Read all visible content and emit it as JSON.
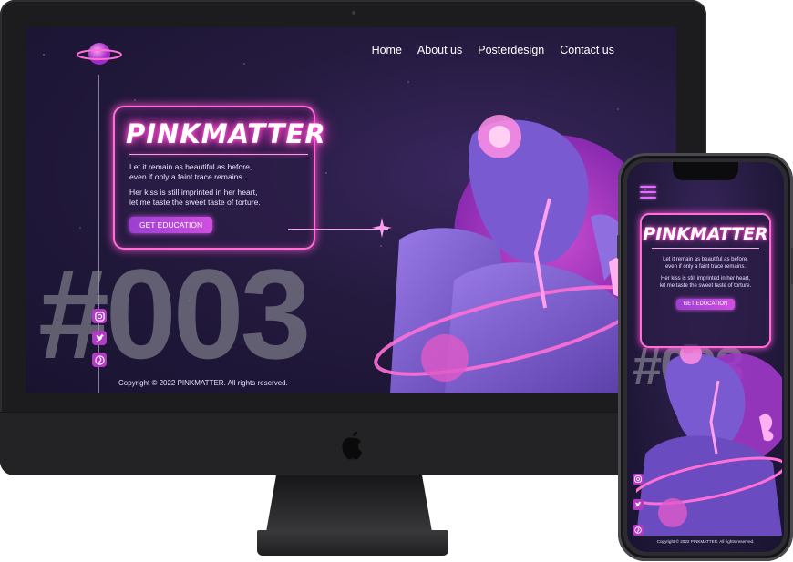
{
  "nav": {
    "items": [
      "Home",
      "About us",
      "Posterdesign",
      "Contact us"
    ]
  },
  "hero": {
    "brand": "PINKMATTER",
    "paragraph1_line1": "Let it remain as beautiful as before,",
    "paragraph1_line2": "even if only a faint trace remains.",
    "paragraph2_line1": "Her kiss is still imprinted in her heart,",
    "paragraph2_line2": "let me taste the sweet taste of torture.",
    "cta_label": "GET EDUCATION",
    "big_number": "#003"
  },
  "phone": {
    "big_number": "#003"
  },
  "social": {
    "icons": [
      "instagram-icon",
      "twitter-icon",
      "pinterest-icon"
    ]
  },
  "footer": {
    "copyright": "Copyright © 2022 PINKMATTER. All rights reserved."
  },
  "colors": {
    "accent_pink": "#ff4fd0",
    "button_purple": "#9b3fd0",
    "background": "#241a3e"
  }
}
